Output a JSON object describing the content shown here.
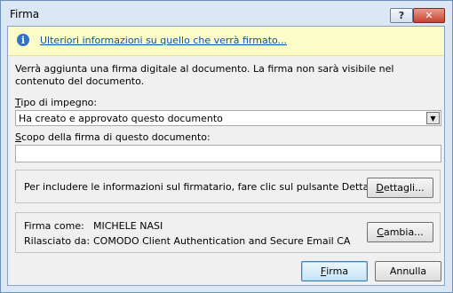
{
  "window": {
    "title": "Firma",
    "help_glyph": "?",
    "close_glyph": "✕"
  },
  "infobar": {
    "icon": "info-icon",
    "icon_glyph": "i",
    "link": "Ulteriori informazioni su quello che verrà firmato..."
  },
  "description": "Verrà aggiunta una firma digitale al documento. La firma non sarà visibile nel contenuto del documento.",
  "commitment": {
    "label_key": "T",
    "label_rest": "ipo di impegno:",
    "selected": "Ha creato e approvato questo documento",
    "arrow": "▼"
  },
  "purpose": {
    "label_key": "S",
    "label_rest": "copo della firma di questo documento:",
    "value": ""
  },
  "details_group": {
    "text": "Per includere le informazioni sul firmatario, fare clic sul pulsante Dettagli.",
    "button_key": "D",
    "button_rest": "ettagli..."
  },
  "signer_group": {
    "sign_as_label": "Firma come:",
    "sign_as_value": "MICHELE NASI",
    "issued_by_label": "Rilasciato da:",
    "issued_by_value": "COMODO Client Authentication and Secure Email CA",
    "change_key": "C",
    "change_rest": "ambia..."
  },
  "buttons": {
    "sign_key": "F",
    "sign_rest": "irma",
    "cancel": "Annulla"
  },
  "colors": {
    "titlebar": "#dbe7f5",
    "infobar": "#fcfcc8",
    "link": "#0b4fb3",
    "close": "#c8432f"
  }
}
